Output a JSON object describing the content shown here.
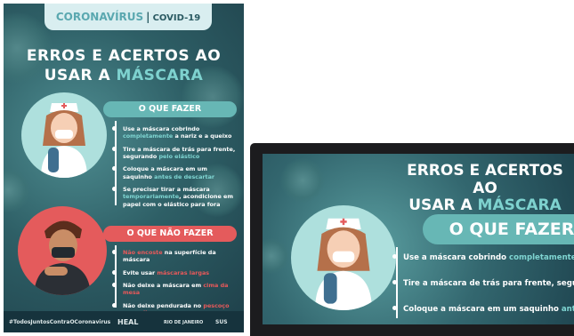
{
  "poster": {
    "header_brand": "CORONAVÍRUS",
    "header_sep": "|",
    "header_tag": "COVID-19",
    "title_line1": "ERROS E ACERTOS AO",
    "title_line2_a": "USAR A ",
    "title_line2_b": "MÁSCARA",
    "do_heading": "O QUE FAZER",
    "do_items": [
      {
        "pre": "Use a máscara cobrindo ",
        "hl": "completamente",
        "post": " a nariz e a queixo"
      },
      {
        "pre": "Tire a máscara de trás para frente, segurando ",
        "hl": "pelo elástico",
        "post": ""
      },
      {
        "pre": "Coloque a máscara em um saquinho ",
        "hl": "antes de descartar",
        "post": ""
      },
      {
        "pre": "Se precisar tirar a máscara ",
        "hl": "temporariamente",
        "post": ", acondicione em papel com o elástico para fora"
      }
    ],
    "dont_heading": "O QUE NÃO FAZER",
    "dont_items": [
      {
        "pre": "",
        "hl": "Não encoste",
        "post": " na superfície da máscara"
      },
      {
        "pre": "Evite usar ",
        "hl": "máscaras largas",
        "post": ""
      },
      {
        "pre": "Não deixe a máscara em ",
        "hl": "cima da mesa",
        "post": ""
      },
      {
        "pre": "Não deixe pendurada no ",
        "hl": "pescoço ou orelha",
        "post": ""
      }
    ],
    "footer_hashtag": "#TodosJuntosContraOCoronavirus",
    "footer_logo1": "HEAL",
    "footer_logo2": "RIO DE JANEIRO",
    "footer_logo3": "SUS"
  },
  "monitor": {
    "title_line1": "ERROS E ACERTOS AO",
    "title_line2_a": "USAR A ",
    "title_line2_b": "MÁSCARA",
    "do_heading": "O QUE FAZER",
    "items": [
      {
        "pre": "Use a máscara cobrindo ",
        "hl": "completamente",
        "post": " a n"
      },
      {
        "pre": "Tire a máscara de trás para frente, segurand",
        "hl": "",
        "post": ""
      },
      {
        "pre": "Coloque a máscara em um saquinho ",
        "hl": "antes d",
        "post": ""
      }
    ]
  },
  "colors": {
    "teal": "#67b7b5",
    "red": "#e45b5c",
    "bg_dark": "#1e3f49"
  }
}
